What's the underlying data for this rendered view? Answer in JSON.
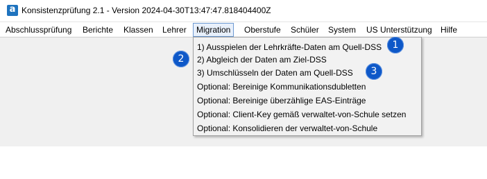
{
  "window": {
    "title": "Konsistenzprüfung 2.1 - Version 2024-04-30T13:47:47.818404400Z",
    "icon": "app-logo-icon",
    "icon_letter": "a"
  },
  "menubar": {
    "items": [
      {
        "label": "Abschlussprüfung"
      },
      {
        "label": "Berichte"
      },
      {
        "label": "Klassen"
      },
      {
        "label": "Lehrer"
      },
      {
        "label": "Migration",
        "active": true
      },
      {
        "label": "Oberstufe"
      },
      {
        "label": "Schüler"
      },
      {
        "label": "System"
      },
      {
        "label": "US Unterstützung"
      },
      {
        "label": "Hilfe"
      }
    ]
  },
  "migration_menu": {
    "items": [
      {
        "label": "1) Ausspielen der Lehrkräfte-Daten am Quell-DSS"
      },
      {
        "label": "2) Abgleich der Daten am Ziel-DSS"
      },
      {
        "label": "3) Umschlüsseln der Daten am Quell-DSS"
      },
      {
        "label": "Optional: Bereinige Kommunikationsdubletten"
      },
      {
        "label": "Optional: Bereinige überzählige EAS-Einträge"
      },
      {
        "label": "Optional: Client-Key gemäß verwaltet-von-Schule setzen"
      },
      {
        "label": "Optional: Konsolidieren der verwaltet-von-Schule"
      }
    ]
  },
  "annotations": {
    "badges": [
      {
        "number": "1"
      },
      {
        "number": "2"
      },
      {
        "number": "3"
      }
    ],
    "badge_color": "#0e58c8"
  }
}
